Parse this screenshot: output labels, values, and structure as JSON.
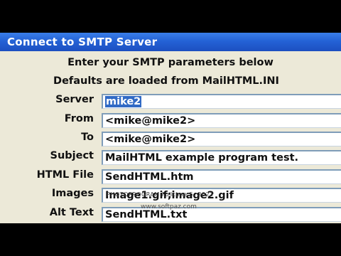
{
  "window": {
    "title": "Connect to SMTP Server"
  },
  "headings": {
    "line1": "Enter your SMTP parameters below",
    "line2": "Defaults are loaded from MailHTML.INI"
  },
  "fields": [
    {
      "label": "Server",
      "value": "mike2"
    },
    {
      "label": "From",
      "value": "<mike@mike2>"
    },
    {
      "label": "To",
      "value": "<mike@mike2>"
    },
    {
      "label": "Subject",
      "value": "MailHTML example program test."
    },
    {
      "label": "HTML File",
      "value": "SendHTML.htm"
    },
    {
      "label": "Images",
      "value": "Image1.gif;image2.gif"
    },
    {
      "label": "Alt Text",
      "value": "SendHTML.txt"
    }
  ],
  "overlay": {
    "caption": "PHOTOPROGRAM  Fulltime  5.  2022",
    "watermark": "www.softpaz.com"
  },
  "colors": {
    "titlebar": "#2462d6",
    "dialog_background": "#ece9d8",
    "selection": "#316ac5",
    "input_border": "#7f9db9"
  }
}
